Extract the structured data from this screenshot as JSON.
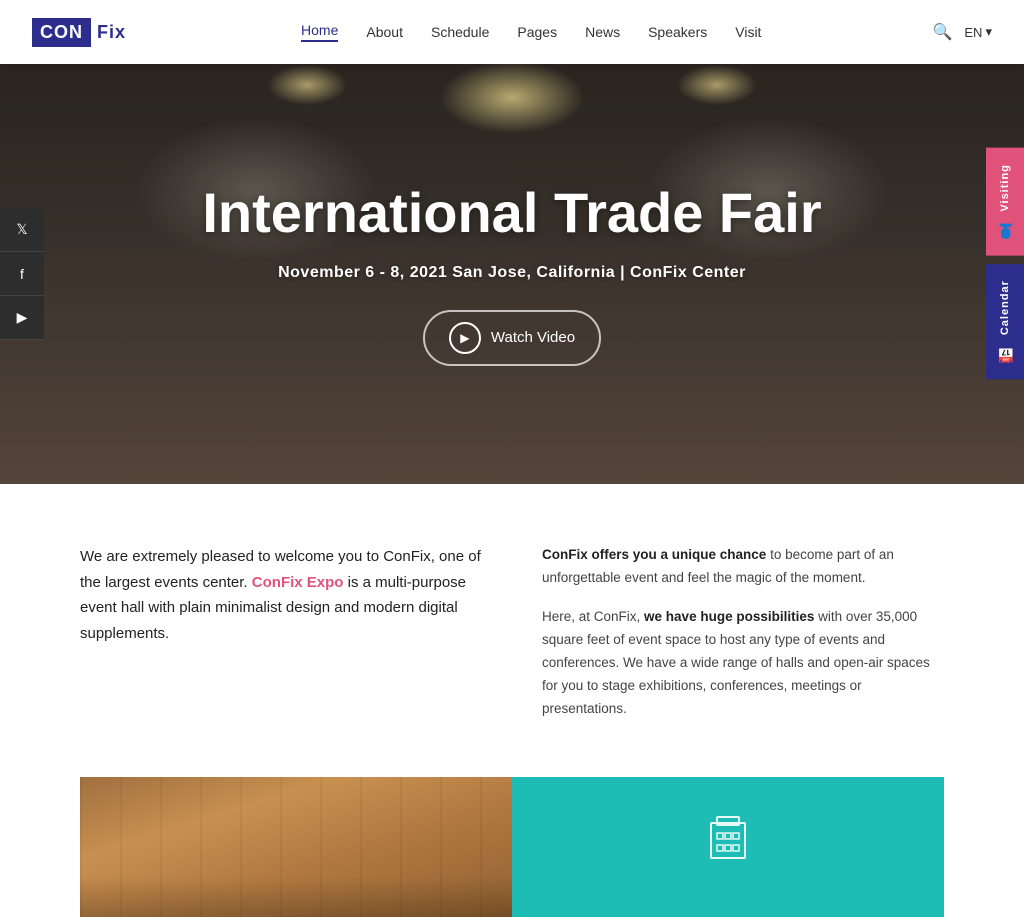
{
  "header": {
    "logo_con": "CON",
    "logo_fix": "Fix",
    "nav": [
      {
        "label": "Home",
        "active": true
      },
      {
        "label": "About",
        "active": false
      },
      {
        "label": "Schedule",
        "active": false
      },
      {
        "label": "Pages",
        "active": false
      },
      {
        "label": "News",
        "active": false
      },
      {
        "label": "Speakers",
        "active": false
      },
      {
        "label": "Visit",
        "active": false
      }
    ],
    "language": "EN"
  },
  "hero": {
    "title": "International Trade Fair",
    "subtitle": "November 6 - 8, 2021 San Jose, California | ConFix Center",
    "watch_video": "Watch Video"
  },
  "social": {
    "twitter": "🐦",
    "facebook": "f",
    "youtube": "▶"
  },
  "right_tabs": {
    "visiting": "Visiting",
    "calendar": "Calendar"
  },
  "content": {
    "left": {
      "intro": "We are extremely pleased to welcome you to ConFix, one of the largest events center.",
      "highlight": "ConFix Expo",
      "rest": " is a multi-purpose event hall with plain minimalist design and modern digital supplements."
    },
    "right": {
      "para1_bold": "ConFix offers you a unique chance",
      "para1_rest": " to become part of an unforgettable event and feel the magic of the moment.",
      "para2_start": "Here, at ConFix, ",
      "para2_bold": "we have huge possibilities",
      "para2_rest": " with over 35,000 square feet of event space to host any type of events and conferences. We have a wide range of halls and open-air spaces for you to stage exhibitions, conferences, meetings or presentations."
    }
  }
}
